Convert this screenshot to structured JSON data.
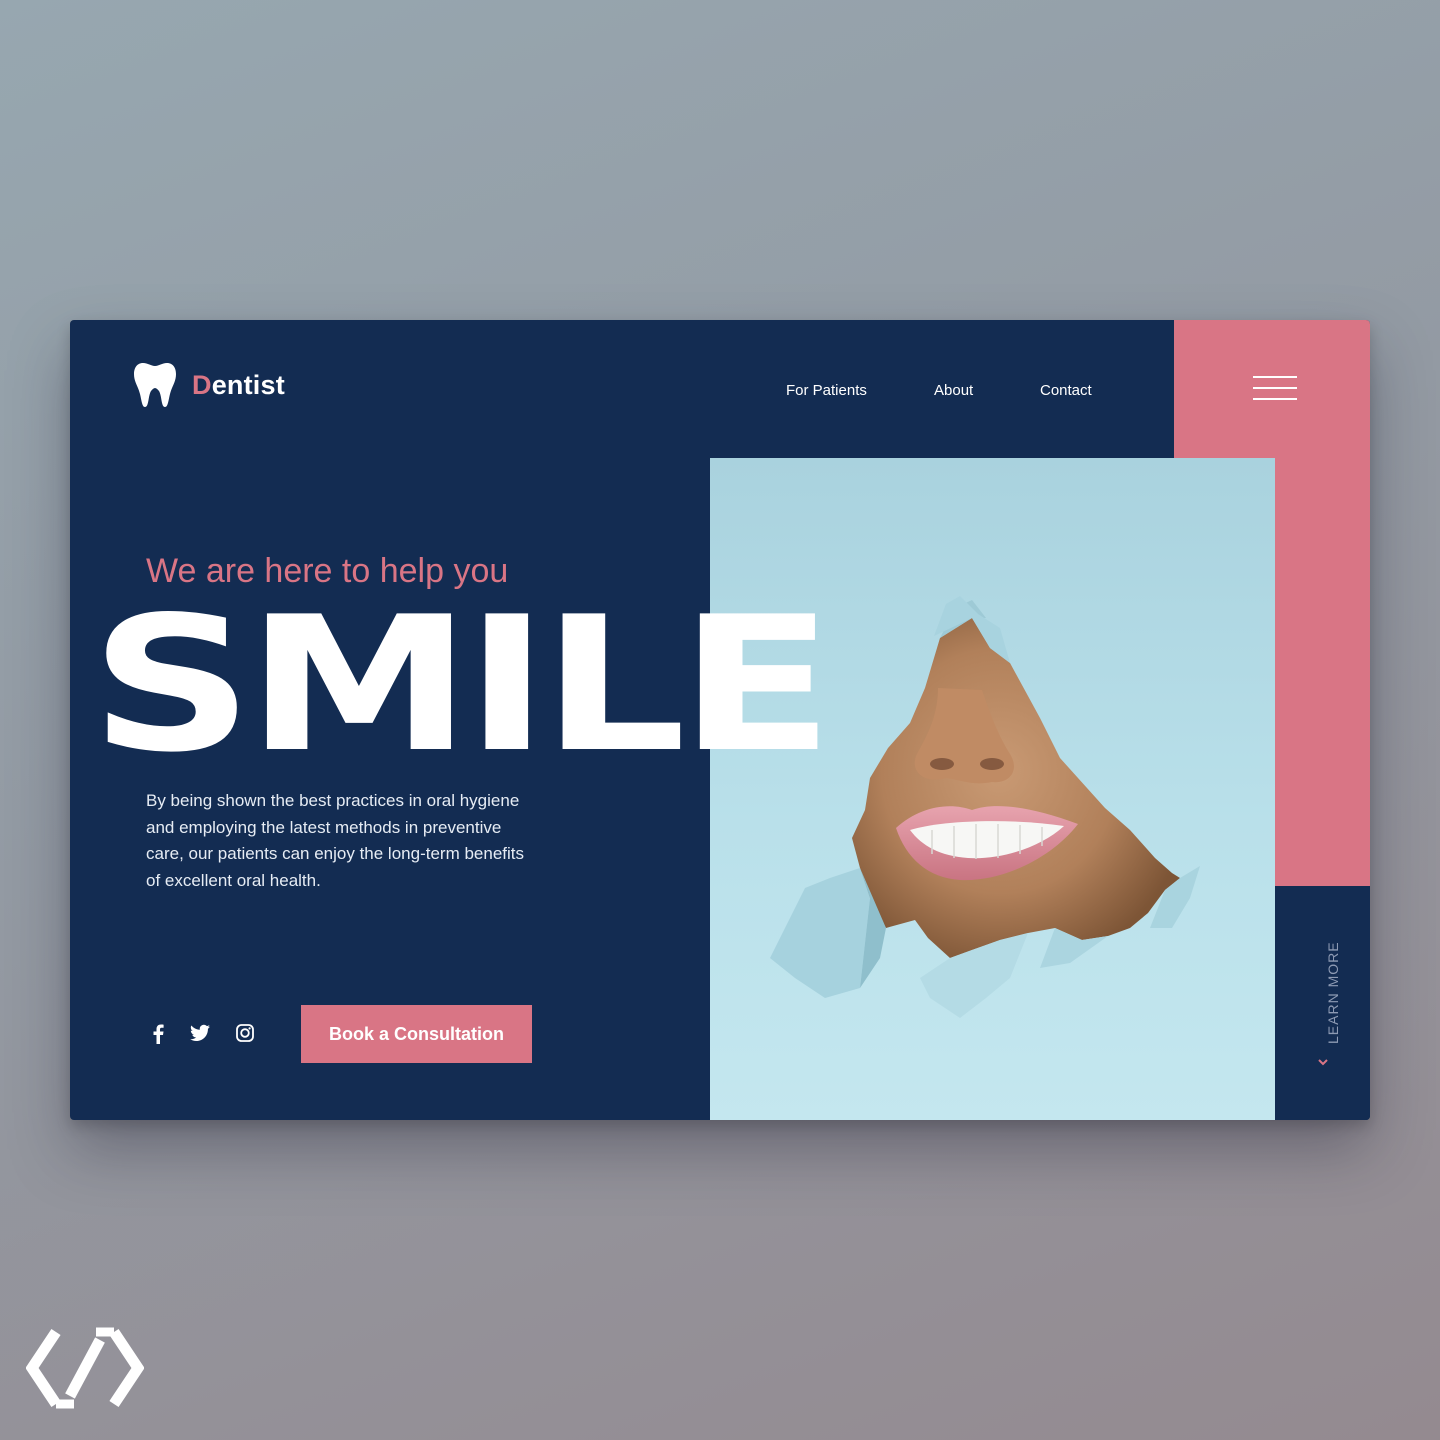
{
  "brand": {
    "first_letter": "D",
    "rest": "entist"
  },
  "nav": {
    "items": [
      {
        "label": "For Patients"
      },
      {
        "label": "About"
      },
      {
        "label": "Contact"
      }
    ]
  },
  "hero": {
    "tagline": "We are here to help you",
    "headline": "SMILE",
    "description": "By being shown the best practices in oral hygiene and employing the latest methods in preventive care, our patients can enjoy the long-term benefits of excellent oral health."
  },
  "cta": {
    "label": "Book a Consultation"
  },
  "social": {
    "icons": [
      "facebook-icon",
      "twitter-icon",
      "instagram-icon"
    ]
  },
  "side": {
    "learn_more": "LEARN MORE"
  },
  "colors": {
    "navy": "#132c52",
    "pink": "#d97585",
    "light_blue": "#bde3ec",
    "white": "#ffffff"
  }
}
